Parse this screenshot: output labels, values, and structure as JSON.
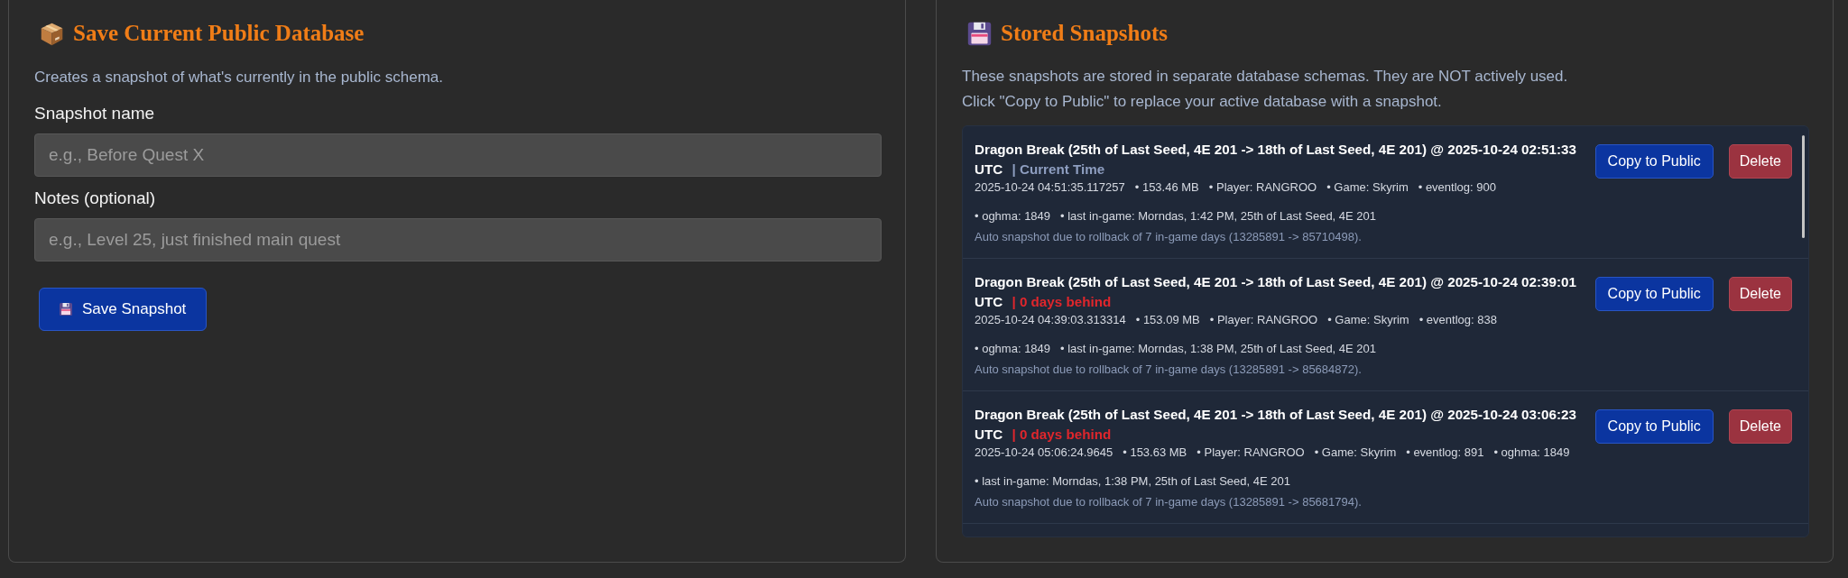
{
  "save_panel": {
    "title": "Save Current Public Database",
    "description": "Creates a snapshot of what's currently in the public schema.",
    "fields": [
      {
        "label": "Snapshot name",
        "placeholder": "e.g., Before Quest X"
      },
      {
        "label": "Notes (optional)",
        "placeholder": "e.g., Level 25, just finished main quest"
      }
    ],
    "button": "Save Snapshot"
  },
  "snapshots_panel": {
    "title": "Stored Snapshots",
    "description": [
      "These snapshots are stored in separate database schemas. They are NOT actively used.",
      "Click \"Copy to Public\" to replace your active database with a snapshot."
    ],
    "snapshots": [
      {
        "title": "Dragon Break (25th of Last Seed, 4E 201 -> 18th of Last Seed, 4E 201) @ 2025-10-24 02:51:33 UTC",
        "status": {
          "kind": "current",
          "text": "| Current Time"
        },
        "details": [
          "2025-10-24 04:51:35.117257",
          "• 153.46 MB",
          "• Player: RANGROO",
          "• Game: Skyrim",
          "• eventlog: 900",
          "• oghma: 1849",
          "• last in-game: Morndas, 1:42 PM, 25th of Last Seed, 4E 201"
        ],
        "note": "Auto snapshot due to rollback of 7 in-game days (13285891 -> 85710498).",
        "actions": [
          {
            "kind": "primary",
            "label": "Copy to Public"
          },
          {
            "kind": "danger",
            "label": "Delete"
          }
        ]
      },
      {
        "title": "Dragon Break (25th of Last Seed, 4E 201 -> 18th of Last Seed, 4E 201) @ 2025-10-24 02:39:01 UTC",
        "status": {
          "kind": "behind",
          "text": "| 0 days behind"
        },
        "details": [
          "2025-10-24 04:39:03.313314",
          "• 153.09 MB",
          "• Player: RANGROO",
          "• Game: Skyrim",
          "• eventlog: 838",
          "• oghma: 1849",
          "• last in-game: Morndas, 1:38 PM, 25th of Last Seed, 4E 201"
        ],
        "note": "Auto snapshot due to rollback of 7 in-game days (13285891 -> 85684872).",
        "actions": [
          {
            "kind": "primary",
            "label": "Copy to Public"
          },
          {
            "kind": "danger",
            "label": "Delete"
          }
        ]
      },
      {
        "title": "Dragon Break (25th of Last Seed, 4E 201 -> 18th of Last Seed, 4E 201) @ 2025-10-24 03:06:23 UTC",
        "status": {
          "kind": "behind",
          "text": "| 0 days behind"
        },
        "details": [
          "2025-10-24 05:06:24.9645",
          "• 153.63 MB",
          "• Player: RANGROO",
          "• Game: Skyrim",
          "• eventlog: 891",
          "• oghma: 1849",
          "• last in-game: Morndas, 1:38 PM, 25th of Last Seed, 4E 201"
        ],
        "note": "Auto snapshot due to rollback of 7 in-game days (13285891 -> 85681794).",
        "actions": [
          {
            "kind": "primary",
            "label": "Copy to Public"
          },
          {
            "kind": "danger",
            "label": "Delete"
          }
        ]
      }
    ]
  }
}
